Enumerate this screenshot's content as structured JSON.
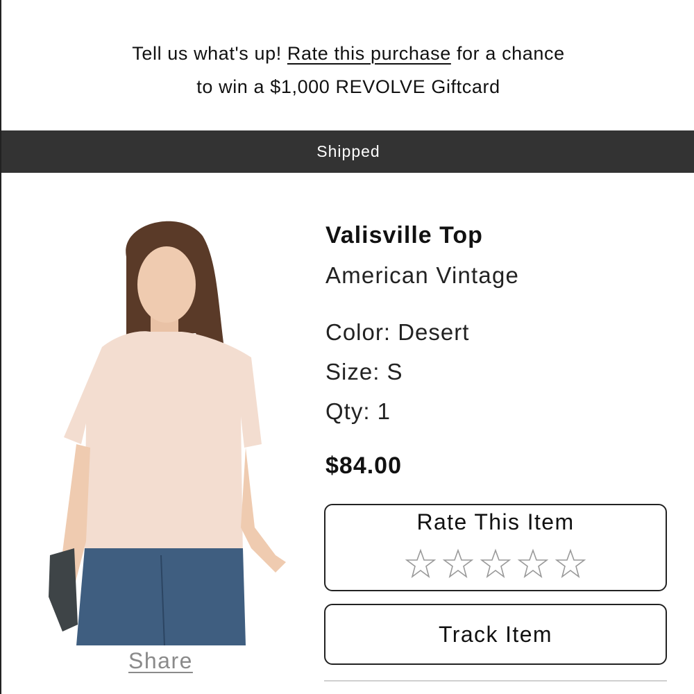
{
  "promo": {
    "prefix": "Tell us what's up! ",
    "link_text": "Rate this purchase",
    "suffix": " for a chance",
    "line2": "to win a $1,000 REVOLVE Giftcard"
  },
  "status": {
    "label": "Shipped",
    "background_color": "#333333"
  },
  "product": {
    "name": "Valisville Top",
    "brand": "American Vintage",
    "color": "Color: Desert",
    "size": "Size: S",
    "qty": "Qty: 1",
    "price": "$84.00",
    "image_alt": "product-photo"
  },
  "share": {
    "label": "Share"
  },
  "rating": {
    "title": "Rate This Item",
    "max_stars": 5,
    "current_rating": 0
  },
  "track": {
    "label": "Track Item"
  }
}
